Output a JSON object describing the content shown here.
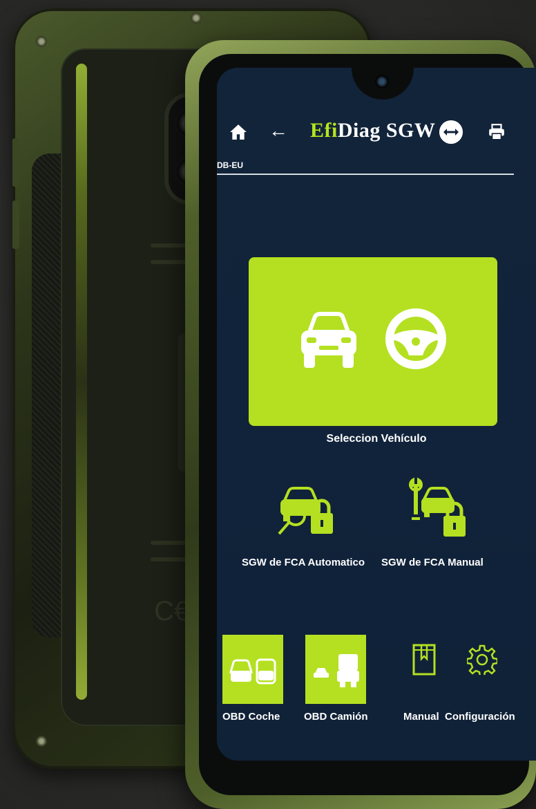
{
  "app": {
    "title_accent": "Efi",
    "title_rest": "Diag SGW",
    "db_label": "DB-EU"
  },
  "colors": {
    "accent": "#b4e021",
    "screen_bg": "#12243a",
    "text": "#ffffff"
  },
  "toolbar": {
    "home_icon": "home-icon",
    "back_icon": "arrow-left-icon",
    "swap_icon": "swap-horizontal-icon",
    "print_icon": "print-icon"
  },
  "main_option": {
    "label": "Seleccion Vehículo",
    "icons": [
      "car-icon",
      "steering-wheel-icon"
    ]
  },
  "options": [
    {
      "label": "SGW de FCA Automatico",
      "icon": "car-search-lock-icon"
    },
    {
      "label": "SGW de FCA Manual",
      "icon": "car-wrench-lock-icon"
    }
  ],
  "bottom": [
    {
      "label": "OBD Coche",
      "icon": "car-suv-icon"
    },
    {
      "label": "OBD Camión",
      "icon": "truck-icon"
    },
    {
      "label": "Manual",
      "icon": "book-icon"
    },
    {
      "label": "Configuración",
      "icon": "gear-icon"
    }
  ]
}
